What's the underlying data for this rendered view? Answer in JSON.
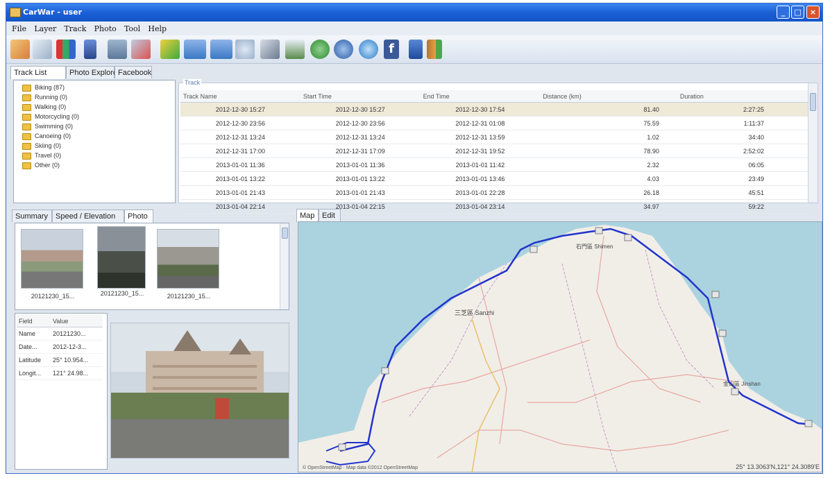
{
  "window": {
    "title": "CarWar - user"
  },
  "menu": [
    "File",
    "Layer",
    "Track",
    "Photo",
    "Tool",
    "Help"
  ],
  "toolbar_icons": [
    "import-icon",
    "map-icon",
    "chart-icon",
    "gps-device-icon",
    "truck-icon",
    "export-icon",
    "edit-track-icon",
    "photo-add-icon",
    "photo-edit-icon",
    "geotag-icon",
    "tools-icon",
    "camera-folder-icon",
    "green-sync-icon",
    "blue-sync-icon",
    "cloud-icon",
    "facebook-icon",
    "help-icon",
    "exit-icon"
  ],
  "top_tabs": [
    "Track List",
    "Photo Explore",
    "Facebook"
  ],
  "categories": [
    "Biking (87)",
    "Running (0)",
    "Walking (0)",
    "Motorcycling (0)",
    "Swimming (0)",
    "Canoeing (0)",
    "Skiing (0)",
    "Travel (0)",
    "Other (0)"
  ],
  "track": {
    "group_label": "Track",
    "columns": [
      "Track Name",
      "Start Time",
      "End Time",
      "Distance (km)",
      "Duration"
    ],
    "rows": [
      [
        "2012-12-30 15:27",
        "2012-12-30 15:27",
        "2012-12-30 17:54",
        "81.40",
        "2:27:25"
      ],
      [
        "2012-12-30 23:56",
        "2012-12-30 23:56",
        "2012-12-31 01:08",
        "75.59",
        "1:11:37"
      ],
      [
        "2012-12-31 13:24",
        "2012-12-31 13:24",
        "2012-12-31 13:59",
        "1.02",
        "34:40"
      ],
      [
        "2012-12-31 17:00",
        "2012-12-31 17:09",
        "2012-12-31 19:52",
        "78.90",
        "2:52:02"
      ],
      [
        "2013-01-01 11:36",
        "2013-01-01 11:36",
        "2013-01-01 11:42",
        "2.32",
        "06:05"
      ],
      [
        "2013-01-01 13:22",
        "2013-01-01 13:22",
        "2013-01-01 13:46",
        "4.03",
        "23:49"
      ],
      [
        "2013-01-01 21:43",
        "2013-01-01 21:43",
        "2013-01-01 22:28",
        "26.18",
        "45:51"
      ],
      [
        "2013-01-04 22:14",
        "2013-01-04 22:15",
        "2013-01-04 23:14",
        "34.97",
        "59:22"
      ]
    ]
  },
  "bottom_tabs": [
    "Summary",
    "Speed / Elevation",
    "Photo"
  ],
  "photos": [
    "20121230_15...",
    "20121230_15...",
    "20121230_15..."
  ],
  "fields": {
    "columns": [
      "Field",
      "Value"
    ],
    "rows": [
      [
        "Name",
        "20121230..."
      ],
      [
        "Date...",
        "2012-12-3..."
      ],
      [
        "Latitude",
        "25° 10.954..."
      ],
      [
        "Longit...",
        "121° 24.98..."
      ]
    ]
  },
  "map": {
    "tabs": [
      "Map",
      "Edit"
    ],
    "labels": [
      "三芝區 Sanzhi",
      "石門區 Shimen",
      "金山區 Jinshan"
    ],
    "coords": "25° 13.3063'N,121° 24.3089'E",
    "attribution": "© OpenStreetMap · Map data ©2012 OpenStreetMap"
  },
  "colors": {
    "track": "#2233cc",
    "sea": "#aad3df",
    "land": "#f1eee8",
    "titlebar": "#1b5fd6"
  }
}
